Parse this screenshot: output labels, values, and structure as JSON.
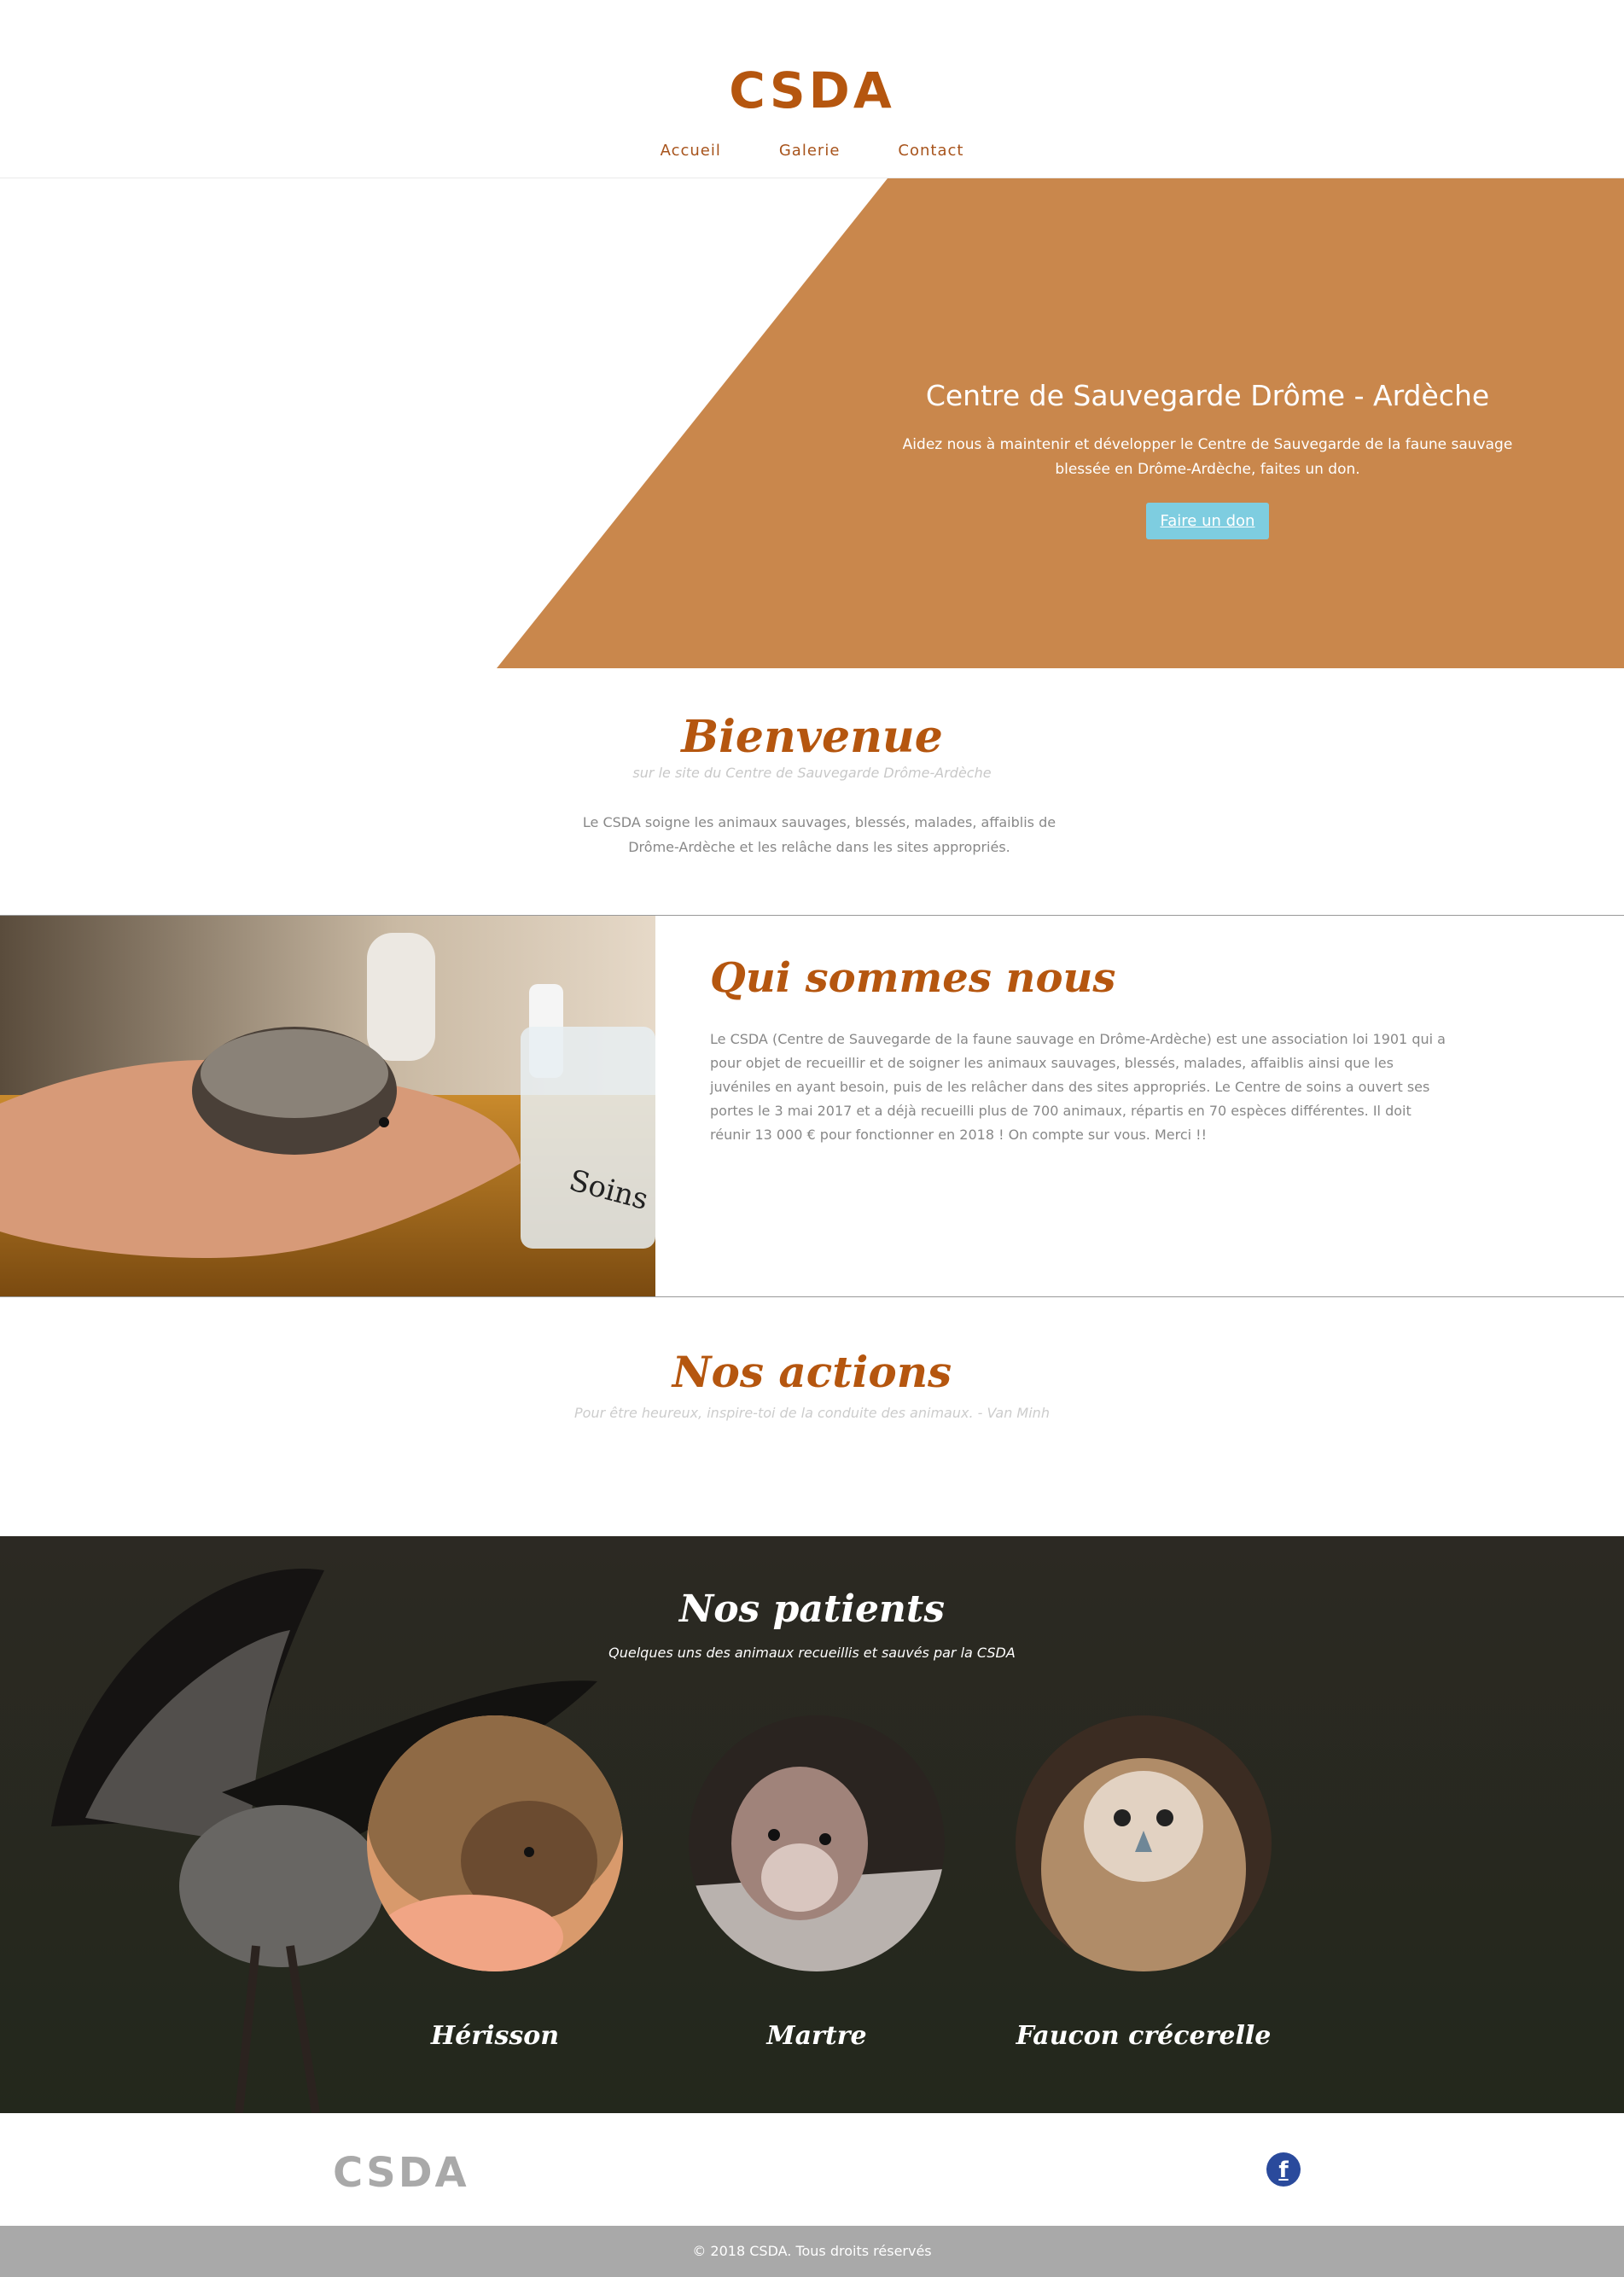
{
  "header": {
    "logo": "CSDA",
    "nav": [
      "Accueil",
      "Galerie",
      "Contact"
    ]
  },
  "hero": {
    "title": "Centre de Sauvegarde Drôme - Ardèche",
    "text": "Aidez nous à maintenir et développer le Centre de Sauvegarde de la faune sauvage blessée en Drôme-Ardèche, faites un don.",
    "button": "Faire un don",
    "color": "#c9874c"
  },
  "bienvenue": {
    "title": "Bienvenue",
    "subtitle": "sur le site du Centre de Sauvegarde Drôme-Ardèche",
    "text": "Le CSDA soigne les animaux sauvages, blessés, malades, affaiblis de Drôme-Ardèche et les relâche dans les sites appropriés."
  },
  "qui": {
    "title": "Qui sommes nous",
    "text": "Le CSDA (Centre de Sauvegarde de la faune sauvage en Drôme-Ardèche) est une association loi 1901 qui a pour objet de recueillir et de soigner les animaux sauvages, blessés, malades, affaiblis ainsi que les juvéniles en ayant besoin, puis de les relâcher dans des sites appropriés. Le Centre de soins a ouvert ses portes le 3 mai 2017 et a déjà recueilli plus de 700 animaux, répartis en 70 espèces différentes. Il doit réunir 13 000 € pour fonctionner en 2018 ! On compte sur vous. Merci !!",
    "image_label": "Soins"
  },
  "actions": {
    "title": "Nos actions",
    "subtitle": "Pour être heureux, inspire-toi de la conduite des animaux. - Van Minh"
  },
  "patients": {
    "title": "Nos patients",
    "subtitle": "Quelques uns des animaux recueillis et sauvés par la CSDA",
    "items": [
      {
        "name": "Hérisson"
      },
      {
        "name": "Martre"
      },
      {
        "name": "Faucon crécerelle"
      }
    ]
  },
  "footer": {
    "logo": "CSDA",
    "social_icon": "facebook-icon",
    "facebook_glyph": "f",
    "copyright": "© 2018 CSDA. Tous droits réservés"
  },
  "colors": {
    "brand": "#b5560f",
    "hero_bg": "#c9874c",
    "button": "#7ecde0",
    "footer_bar": "#a9a9a9"
  }
}
